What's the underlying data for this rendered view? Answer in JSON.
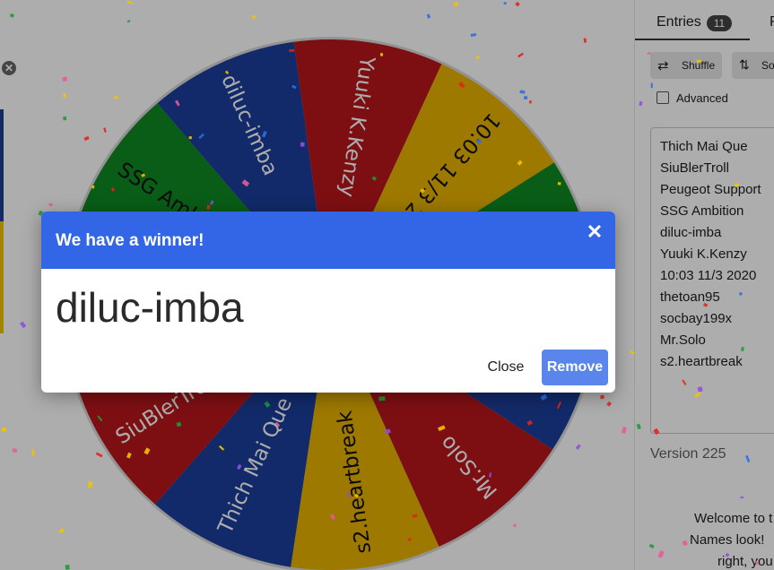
{
  "wheel": {
    "entries": [
      {
        "label": "Thich Mai Que",
        "color": "#1b3f9b"
      },
      {
        "label": "SiuBlerTroll",
        "color": "#b8171d"
      },
      {
        "label": "Peugeot Support",
        "color": "#e8b300"
      },
      {
        "label": "SSG Ambition",
        "color": "#0e8a21"
      },
      {
        "label": "diluc-imba",
        "color": "#1b3f9b"
      },
      {
        "label": "Yuuki K.Kenzy",
        "color": "#b8171d"
      },
      {
        "label": "10:03 11/3 2020",
        "color": "#e8b300"
      },
      {
        "label": "thetoan95",
        "color": "#0e8a21"
      },
      {
        "label": "socbay199x",
        "color": "#1b3f9b"
      },
      {
        "label": "Mr.Solo",
        "color": "#b8171d"
      },
      {
        "label": "s2.heartbreak",
        "color": "#e8b300"
      }
    ]
  },
  "sidebar": {
    "tab_entries_label": "Entries",
    "entries_count": "11",
    "tab_results_label": "R",
    "shuffle_label": "Shuffle",
    "sort_label": "So",
    "advanced_label": "Advanced",
    "entries_text": [
      "Thich Mai Que",
      "SiuBlerTroll",
      "Peugeot Support",
      "SSG Ambition",
      "diluc-imba",
      "Yuuki K.Kenzy",
      "10:03 11/3 2020",
      "thetoan95",
      "socbay199x",
      "Mr.Solo",
      "s2.heartbreak"
    ],
    "version": "Version 225",
    "welcome_lines": [
      "Welcome to t",
      "Names look!",
      "right, you"
    ]
  },
  "dialog": {
    "title": "We have a winner!",
    "close_glyph": "✕",
    "winner": "diluc-imba",
    "close_label": "Close",
    "remove_label": "Remove"
  },
  "icons": {
    "shuffle": "shuffle-icon",
    "sort": "sort-icon",
    "close_circle": "✕"
  }
}
